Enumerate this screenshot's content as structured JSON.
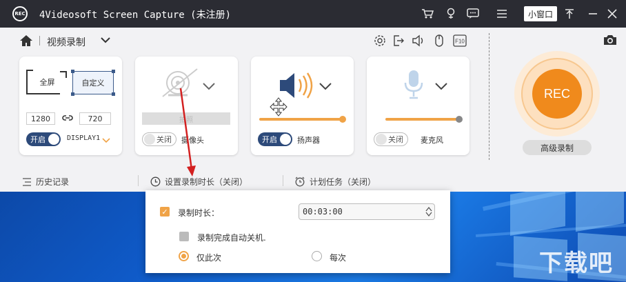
{
  "window": {
    "app_title": "4Videosoft Screen Capture (未注册)",
    "logo_text": "REC",
    "mini_window_label": "小窗口"
  },
  "titlebar_icons": [
    "cart-icon",
    "bulb-icon",
    "chat-icon",
    "menu-icon",
    "pin-icon",
    "minimize-icon",
    "close-icon"
  ],
  "mode": {
    "label": "视频录制"
  },
  "tools": [
    "gear-icon",
    "export-icon",
    "speaker-small-icon",
    "mouse-icon",
    "f10-icon"
  ],
  "f10_text": "F10",
  "screen_panel": {
    "full_label": "全屏",
    "custom_label": "自定义",
    "width": "1280",
    "height": "720",
    "toggle_label": "开启",
    "display_label": "DISPLAY1"
  },
  "camera_panel": {
    "bar_label": "拍照",
    "toggle_label": "关闭",
    "caption": "摄像头"
  },
  "speaker_panel": {
    "toggle_label": "开启",
    "caption": "扬声器",
    "volume": 1.0
  },
  "mic_panel": {
    "toggle_label": "关闭",
    "caption": "麦克风",
    "volume": 1.0
  },
  "rec": {
    "button_label": "REC",
    "advanced_label": "高级录制"
  },
  "bottom": {
    "history": "历史记录",
    "duration": "设置录制时长（关闭）",
    "schedule": "计划任务（关闭）"
  },
  "popup": {
    "duration_label": "录制时长：",
    "duration_value": "00:03:00",
    "shutdown_label": "录制完成自动关机.",
    "once_label": "仅此次",
    "every_label": "每次"
  },
  "watermark": "下载吧",
  "colors": {
    "titlebar": "#2b2c33",
    "accent": "#f08a1c",
    "toggle_on": "#2d4a7a",
    "arrow": "#d32020"
  }
}
